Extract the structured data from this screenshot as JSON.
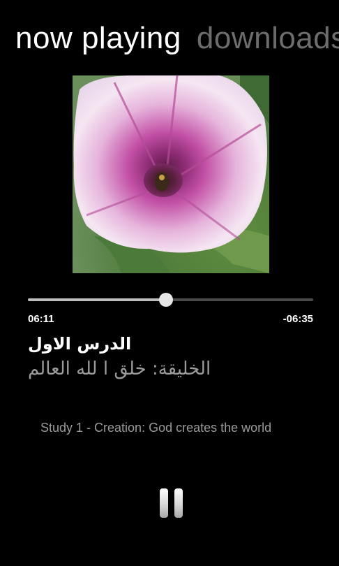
{
  "pivot": {
    "tabs": [
      {
        "label": "now playing",
        "active": true
      },
      {
        "label": "downloads",
        "active": false
      }
    ]
  },
  "player": {
    "progress_fraction": 0.484,
    "elapsed": "06:11",
    "remaining": "-06:35",
    "title": "الدرس الاول",
    "subtitle": "الخليقة: خلق ا لله العالم",
    "description": "Study 1 - Creation: God creates the world",
    "play_state_icon": "pause-icon"
  },
  "colors": {
    "background": "#000000",
    "accent_text": "#ffffff",
    "secondary_text": "#9a9a9a",
    "inactive_tab": "#6d6d6d"
  }
}
